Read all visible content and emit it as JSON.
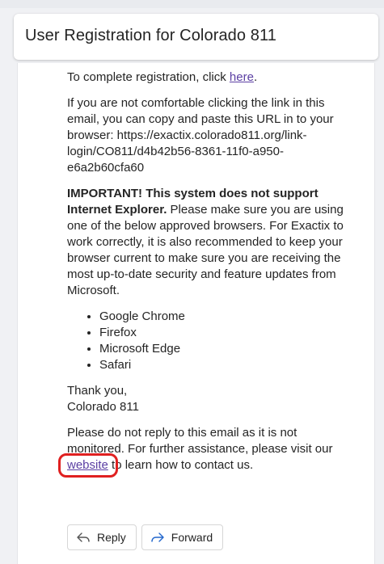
{
  "email": {
    "subject": "User Registration for Colorado 811",
    "body": {
      "p1_prefix": "To complete registration, click ",
      "p1_link": "here",
      "p1_suffix": ".",
      "p2": "If you are not comfortable clicking the link in this email, you can copy and paste this URL in to your browser: https://exactix.colorado811.org/link-login/CO811/d4b42b56-8361-11f0-a950-e6a2b60cfa60",
      "p3_bold": "IMPORTANT! This system does not support Internet Explorer.",
      "p3_rest": " Please make sure you are using one of the below approved browsers. For Exactix to work correctly, it is also recommended to keep your browser current to make sure you are receiving the most up-to-date security and feature updates from Microsoft.",
      "browsers": [
        "Google Chrome",
        "Firefox",
        "Microsoft Edge",
        "Safari"
      ],
      "thanks_line1": "Thank you,",
      "thanks_line2": "Colorado 811",
      "footer_prefix": "Please do not reply to this email as it is not monitored. For further assistance, please visit our ",
      "footer_link": "website",
      "footer_suffix": " to learn how to contact us."
    }
  },
  "actions": {
    "reply_label": "Reply",
    "forward_label": "Forward"
  },
  "colors": {
    "link": "#5b3fa3",
    "highlight": "#e02020",
    "forward_icon": "#2266cc"
  },
  "icons": {
    "reply": "reply-icon",
    "forward": "forward-icon"
  }
}
